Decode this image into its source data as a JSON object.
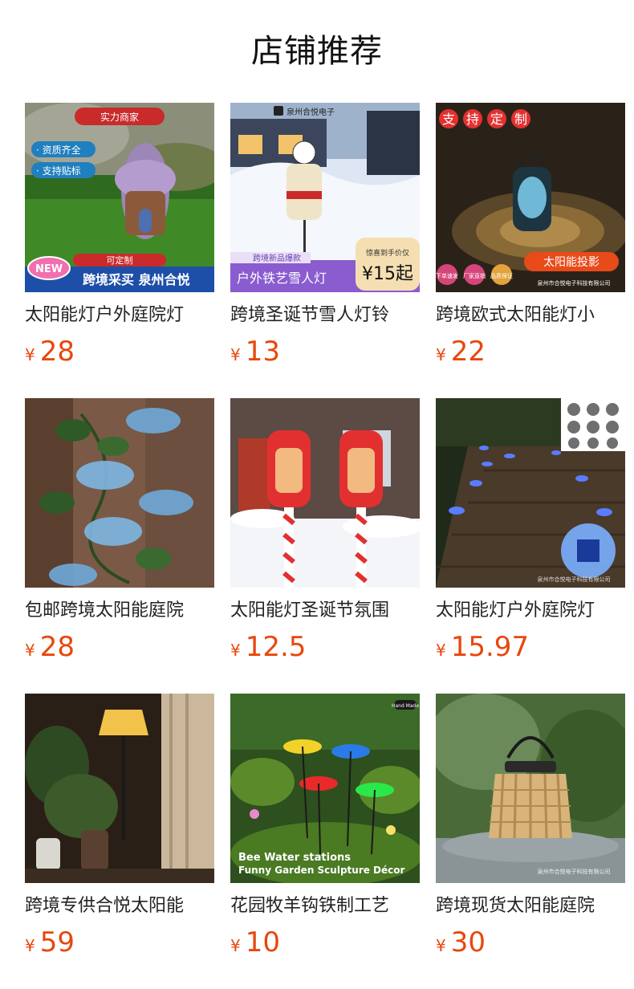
{
  "page": {
    "title": "店铺推荐",
    "currency_symbol": "¥",
    "price_color": "#e8470c"
  },
  "products": [
    {
      "name": "太阳能灯户外庭院灯",
      "price": "28",
      "image_icon": "fairy-house-solar-light-image",
      "image_text": {
        "badge1": "实力商家",
        "tag1": "· 资质齐全",
        "tag2": "· 支持贴标",
        "new": "NEW",
        "custom": "可定制",
        "bottom": "跨境采买 泉州合悦"
      }
    },
    {
      "name": "跨境圣诞节雪人灯铃",
      "price": "13",
      "image_icon": "snowman-stake-light-image",
      "image_text": {
        "brand": "泉州合悦电子",
        "tag": "跨境新品爆款",
        "bottom": "户外铁艺雪人灯",
        "price_badge": "¥15起",
        "price_note": "惊喜到手价仅"
      }
    },
    {
      "name": "跨境欧式太阳能灯小",
      "price": "22",
      "image_icon": "projection-lantern-image",
      "image_text": {
        "chips": [
          "支",
          "持",
          "定",
          "制"
        ],
        "banner": "太阳能投影",
        "badge1": "下单速发",
        "badge2": "厂家直销",
        "badge3": "品质保证",
        "footer": "泉州市合悦电子科技有限公司"
      }
    },
    {
      "name": "包邮跨境太阳能庭院",
      "price": "28",
      "image_icon": "morning-glory-string-lights-image",
      "image_text": {}
    },
    {
      "name": "太阳能灯圣诞节氛围",
      "price": "12.5",
      "image_icon": "candy-cane-lantern-image",
      "image_text": {}
    },
    {
      "name": "太阳能灯户外庭院灯",
      "price": "15.97",
      "image_icon": "solar-deck-lights-image",
      "image_text": {
        "footer": "泉州市合悦电子科技有限公司"
      }
    },
    {
      "name": "跨境专供合悦太阳能",
      "price": "59",
      "image_icon": "rattan-floor-lamp-image",
      "image_text": {}
    },
    {
      "name": "花园牧羊钩铁制工艺",
      "price": "10",
      "image_icon": "bee-water-stations-image",
      "image_text": {
        "line1": "Bee Water stations",
        "line2": "Funny Garden Sculpture Décor",
        "corner": "Hand Made"
      }
    },
    {
      "name": "跨境现货太阳能庭院",
      "price": "30",
      "image_icon": "rattan-lantern-image",
      "image_text": {
        "footer": "泉州市合悦电子科技有限公司"
      }
    }
  ]
}
